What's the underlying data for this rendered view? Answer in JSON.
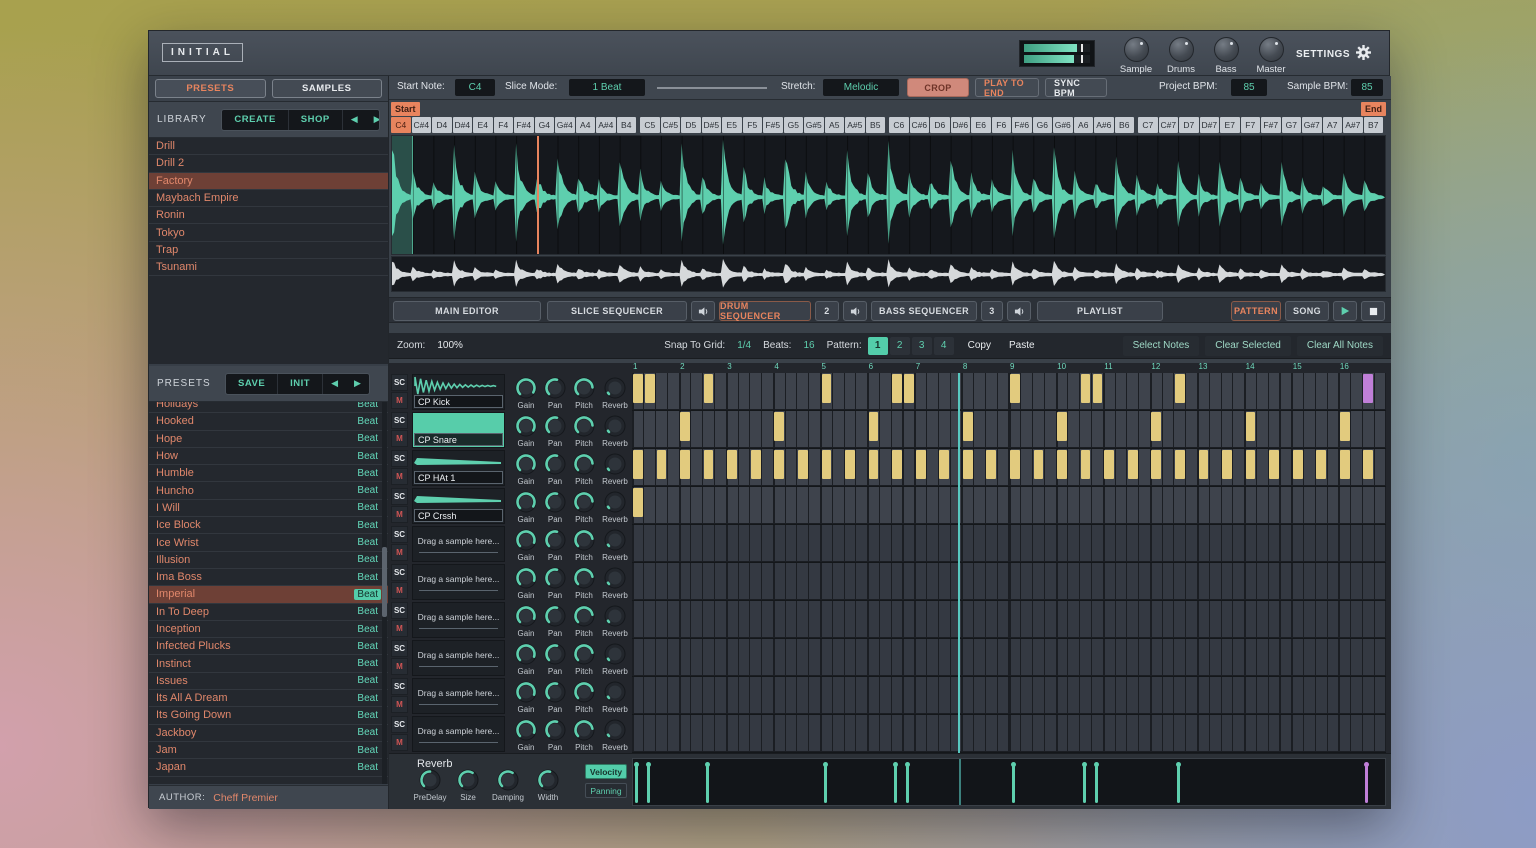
{
  "app": {
    "logo": "INITIAL",
    "settings": "SETTINGS"
  },
  "master_knobs": [
    "Sample",
    "Drums",
    "Bass",
    "Master"
  ],
  "sidebar": {
    "tabs": {
      "presets": "PRESETS",
      "samples": "SAMPLES"
    },
    "library": {
      "title": "LIBRARY",
      "create": "CREATE",
      "shop": "SHOP",
      "items": [
        "Drill",
        "Drill 2",
        "Factory",
        "Maybach Empire",
        "Ronin",
        "Tokyo",
        "Trap",
        "Tsunami"
      ],
      "selected": "Factory"
    },
    "presets": {
      "title": "PRESETS",
      "save": "SAVE",
      "init": "INIT",
      "tag": "Beat",
      "selected": "Imperial",
      "items": [
        "Holidays",
        "Hooked",
        "Hope",
        "How",
        "Humble",
        "Huncho",
        "I Will",
        "Ice Block",
        "Ice Wrist",
        "Illusion",
        "Ima Boss",
        "Imperial",
        "In To Deep",
        "Inception",
        "Infected Plucks",
        "Instinct",
        "Issues",
        "Its All A Dream",
        "Its Going Down",
        "Jackboy",
        "Jam",
        "Japan"
      ]
    },
    "author_label": "AUTHOR:",
    "author": "Cheff Premier"
  },
  "sample_controls": {
    "start_note_label": "Start Note:",
    "start_note": "C4",
    "slice_mode_label": "Slice Mode:",
    "slice_mode": "1 Beat",
    "stretch_label": "Stretch:",
    "stretch": "Melodic",
    "crop": "CROP",
    "play_to_end": "PLAY TO END",
    "sync_bpm": "SYNC BPM",
    "project_bpm_label": "Project BPM:",
    "project_bpm": "85",
    "sample_bpm_label": "Sample BPM:",
    "sample_bpm": "85"
  },
  "note_strip": {
    "start_label": "Start",
    "end_label": "End",
    "active_note": "C4",
    "notes": [
      "C4",
      "C#4",
      "D4",
      "D#4",
      "E4",
      "F4",
      "F#4",
      "G4",
      "G#4",
      "A4",
      "A#4",
      "B4",
      "C5",
      "C#5",
      "D5",
      "D#5",
      "E5",
      "F5",
      "F#5",
      "G5",
      "G#5",
      "A5",
      "A#5",
      "B5",
      "C6",
      "C#6",
      "D6",
      "D#6",
      "E6",
      "F6",
      "F#6",
      "G6",
      "G#6",
      "A6",
      "A#6",
      "B6",
      "C7",
      "C#7",
      "D7",
      "D#7",
      "E7",
      "F7",
      "F#7",
      "G7",
      "G#7",
      "A7",
      "A#7",
      "B7"
    ]
  },
  "mode_tabs": {
    "main_editor": "MAIN EDITOR",
    "slice_sequencer": "SLICE SEQUENCER",
    "drum_sequencer": "DRUM SEQUENCER",
    "drum_num": "2",
    "bass_sequencer": "BASS SEQUENCER",
    "bass_num": "3",
    "playlist": "PLAYLIST",
    "pattern": "PATTERN",
    "song": "SONG"
  },
  "seq_controls": {
    "zoom_label": "Zoom:",
    "zoom": "100%",
    "snap_label": "Snap To Grid:",
    "snap": "1/4",
    "beats_label": "Beats:",
    "beats": "16",
    "pattern_label": "Pattern:",
    "patterns": [
      "1",
      "2",
      "3",
      "4"
    ],
    "active_pattern": "1",
    "copy": "Copy",
    "paste": "Paste",
    "select_notes": "Select Notes",
    "clear_selected": "Clear Selected",
    "clear_all": "Clear All Notes"
  },
  "drum_machine": {
    "sc": "SC",
    "mute": "M",
    "knob_labels": [
      "Gain",
      "Pan",
      "Pitch",
      "Reverb"
    ],
    "channels": [
      "CP Kick",
      "CP Snare",
      "CP HAt 1",
      "CP Crssh"
    ],
    "empty_slot": "Drag a sample here...",
    "empty_rows": 6
  },
  "sequencer": {
    "beats": 16,
    "steps_per_beat": 4,
    "beat_labels": [
      "1",
      "2",
      "3",
      "4",
      "5",
      "6",
      "7",
      "8",
      "9",
      "10",
      "11",
      "12",
      "13",
      "14",
      "15",
      "16"
    ],
    "tracks": [
      {
        "name": "CP Kick",
        "steps": [
          0,
          1,
          6,
          16,
          22,
          23,
          32,
          38,
          39,
          46
        ],
        "accent_steps": [
          62
        ]
      },
      {
        "name": "CP Snare",
        "steps": [
          4,
          12,
          20,
          28,
          36,
          44,
          52,
          60
        ],
        "accent_steps": []
      },
      {
        "name": "CP HAt 1",
        "steps": [
          0,
          2,
          4,
          6,
          8,
          10,
          12,
          14,
          16,
          18,
          20,
          22,
          24,
          26,
          28,
          30,
          32,
          34,
          36,
          38,
          40,
          42,
          44,
          46,
          48,
          50,
          52,
          54,
          56,
          58,
          60,
          62
        ],
        "accent_steps": []
      },
      {
        "name": "CP Crssh",
        "steps": [
          0
        ],
        "accent_steps": []
      }
    ],
    "playhead_step": 27.7
  },
  "effects": {
    "title": "Reverb",
    "knob_labels": [
      "PreDelay",
      "Size",
      "Damping",
      "Width"
    ],
    "velocity": "Velocity",
    "panning": "Panning"
  },
  "colors": {
    "accent_teal": "#5ecfae",
    "accent_orange": "#e8845e",
    "note_yellow": "#e2cb7e",
    "note_purple": "#c07fd8",
    "crop_bg": "#d0897b"
  }
}
